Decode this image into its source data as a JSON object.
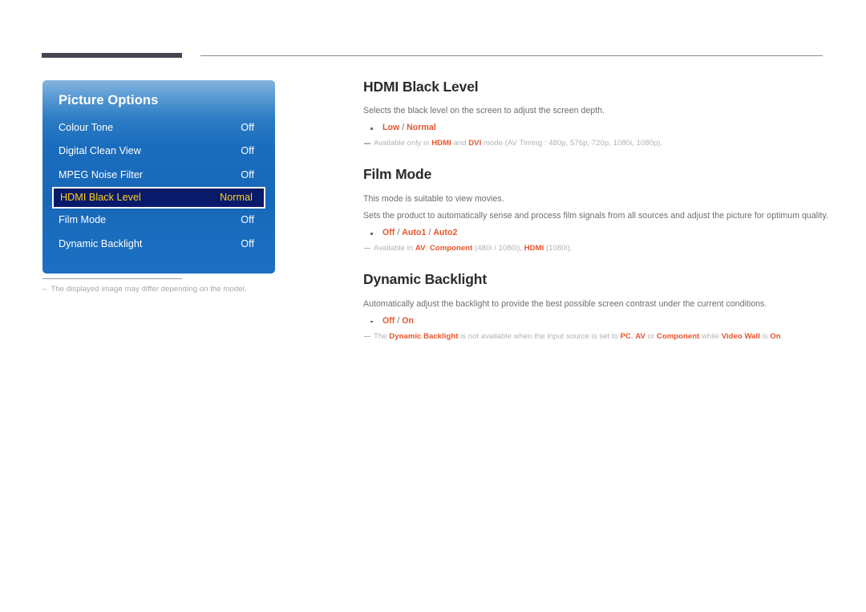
{
  "page": {
    "header_rule_dark": "#474352",
    "header_rule_thin": "#8d8d92",
    "accent_orange": "#e8552d",
    "body_gray": "#6e6d74",
    "footnote_gray": "#b3b2b9"
  },
  "osd": {
    "title": "Picture Options",
    "panel_colors": {
      "gradient_top": "#86b4de",
      "gradient_bottom": "#1d6fc2",
      "selected_bg": "#091a6b",
      "selected_border": "#ffffff",
      "selected_text": "#ffd11a"
    },
    "rows": [
      {
        "label": "Colour Tone",
        "value": "Off",
        "selected": false
      },
      {
        "label": "Digital Clean View",
        "value": "Off",
        "selected": false
      },
      {
        "label": "MPEG Noise Filter",
        "value": "Off",
        "selected": false
      },
      {
        "label": "HDMI Black Level",
        "value": "Normal",
        "selected": true
      },
      {
        "label": "Film Mode",
        "value": "Off",
        "selected": false
      },
      {
        "label": "Dynamic Backlight",
        "value": "Off",
        "selected": false
      }
    ],
    "note_dash": "–",
    "note": "The displayed image may differ depending on the model."
  },
  "sections": {
    "hdmi_black_level": {
      "title": "HDMI Black Level",
      "description": "Selects the black level on the screen to adjust the screen depth.",
      "options": "Low / Normal",
      "options_parts": {
        "first": "Low",
        "sep": " / ",
        "second": "Normal"
      },
      "footnote_plain_1": "Available only in ",
      "footnote_bold_1": "HDMI",
      "footnote_plain_2": " and ",
      "footnote_bold_2": "DVI",
      "footnote_plain_3": " mode (AV Timing : 480p, 576p, 720p, 1080i, 1080p)."
    },
    "film_mode": {
      "title": "Film Mode",
      "description_1": "This mode is suitable to view movies.",
      "description_2": "Sets the product to automatically sense and process film signals from all sources and adjust the picture for optimum quality.",
      "options": "Off / Auto1 / Auto2",
      "footnote_plain_1": "Available in ",
      "footnote_bold_1": "AV",
      "footnote_plain_2": ", ",
      "footnote_bold_2": "Component",
      "footnote_plain_3": " (480i / 1080i), ",
      "footnote_bold_3": "HDMI",
      "footnote_plain_4": " (1080i)."
    },
    "dynamic_backlight": {
      "title": "Dynamic Backlight",
      "description": "Automatically adjust the backlight to provide the best possible screen contrast under the current conditions.",
      "options": "Off / On",
      "footnote_plain_1": "The ",
      "footnote_bold_1": "Dynamic Backlight",
      "footnote_plain_2": " is not available when the input source is set to ",
      "footnote_bold_2": "PC",
      "footnote_plain_3": ", ",
      "footnote_bold_3": "AV",
      "footnote_plain_4": " or ",
      "footnote_bold_4": "Component",
      "footnote_plain_5": " while ",
      "footnote_bold_5": "Video Wall",
      "footnote_plain_6": " is ",
      "footnote_bold_6": "On",
      "footnote_plain_7": "."
    }
  }
}
